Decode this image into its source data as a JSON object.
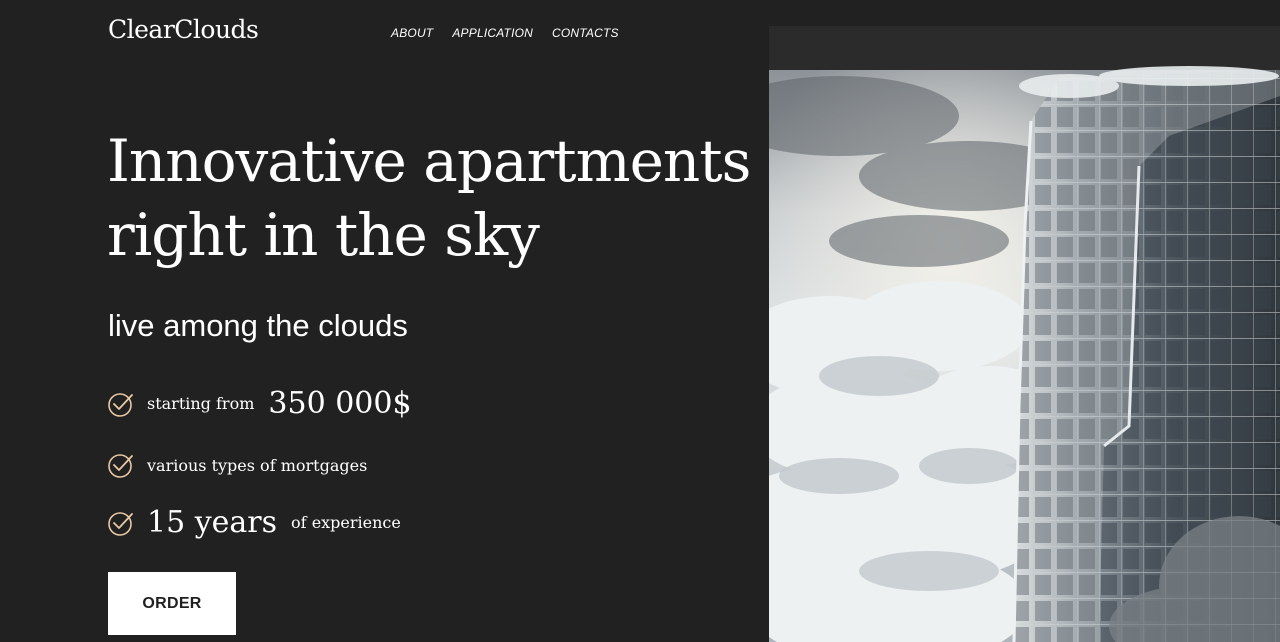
{
  "brand": {
    "logo": "ClearClouds"
  },
  "nav": [
    {
      "label": "ABOUT"
    },
    {
      "label": "APPLICATION"
    },
    {
      "label": "CONTACTS"
    }
  ],
  "hero": {
    "title_line1": "Innovative apartments",
    "title_line2": "right in the sky",
    "subtitle": "live among the clouds"
  },
  "features": [
    {
      "prefix": "starting from",
      "highlight": "350 000$",
      "suffix": ""
    },
    {
      "prefix": "various types of mortgages",
      "highlight": "",
      "suffix": ""
    },
    {
      "prefix": "",
      "highlight": "15 years",
      "suffix": "of experience"
    }
  ],
  "cta": {
    "order_label": "ORDER"
  },
  "colors": {
    "background": "#212121",
    "accent_check": "#e8c9a3",
    "text": "#ffffff"
  },
  "icons": {
    "check": "check-circle-icon"
  }
}
